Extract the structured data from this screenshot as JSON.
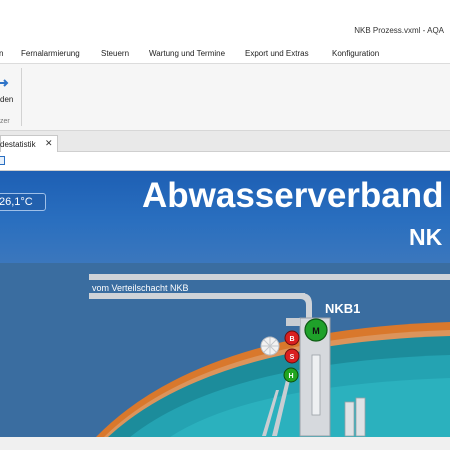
{
  "window": {
    "title": "NKB Prozess.vxml - AQA"
  },
  "menu": {
    "items": [
      {
        "label": "Fernalarmierung"
      },
      {
        "label": "Steuern"
      },
      {
        "label": "Wartung und Termine"
      },
      {
        "label": "Export und Extras"
      },
      {
        "label": "Konfiguration"
      }
    ]
  },
  "ribbon": {
    "button_label": "den",
    "group_label": "zer",
    "icon": "arrow-icon"
  },
  "tabs": {
    "doc_tab_label": "destatistik",
    "close_glyph": "✕"
  },
  "scada": {
    "temperature": "26,1°C",
    "title": "Abwasserverband",
    "subtitle": "NK",
    "pipe_label": "vom Verteilschacht NKB",
    "basin_label": "NKB1",
    "motor_label": "M",
    "indicators": [
      {
        "label": "B",
        "color": "#d91f1f"
      },
      {
        "label": "S",
        "color": "#d91f1f"
      },
      {
        "label": "H",
        "color": "#21a521"
      }
    ],
    "colors": {
      "header": "#1d5fb4",
      "background": "#3a6da0",
      "basin_rim": "#d9782c",
      "water": "#1f9aa8",
      "pipe": "#c9cdd2",
      "motor": "#1fa12a"
    }
  }
}
